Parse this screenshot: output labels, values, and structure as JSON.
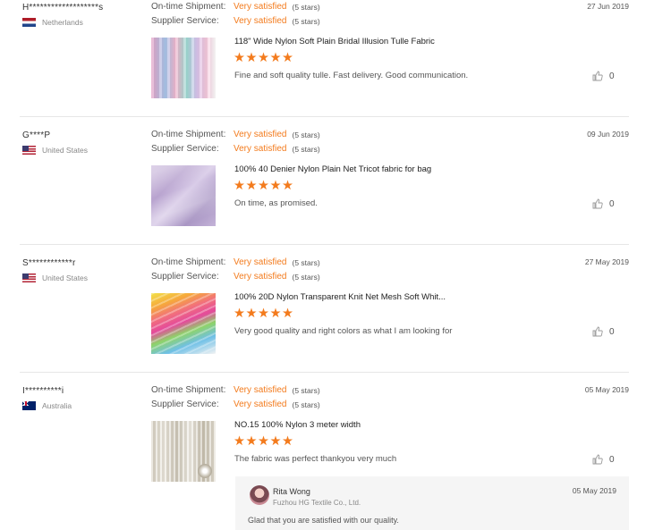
{
  "labels": {
    "on_time": "On-time Shipment:",
    "supplier": "Supplier Service:"
  },
  "colors": {
    "accent": "#f37b1d",
    "separator": "#e6e6e6",
    "reply_bg": "#f5f5f5"
  },
  "reviews": [
    {
      "buyer": "H*******************s",
      "country": "Netherlands",
      "flag": "flag-nl",
      "date": "27 Jun 2019",
      "on_time_value": "Very satisfied",
      "on_time_stars": "(5 stars)",
      "supplier_value": "Very satisfied",
      "supplier_stars": "(5 stars)",
      "product": "118\" Wide Nylon Soft Plain Bridal Illusion Tulle Fabric",
      "stars": "★★★★★",
      "rating": 5,
      "comment": "Fine and soft quality tulle. Fast delivery. Good communication.",
      "likes": "0"
    },
    {
      "buyer": "G****P",
      "country": "United States",
      "flag": "flag-us",
      "date": "09 Jun 2019",
      "on_time_value": "Very satisfied",
      "on_time_stars": "(5 stars)",
      "supplier_value": "Very satisfied",
      "supplier_stars": "(5 stars)",
      "product": "100% 40 Denier Nylon Plain Net Tricot fabric for bag",
      "stars": "★★★★★",
      "rating": 5,
      "comment": "On time, as promised.",
      "likes": "0"
    },
    {
      "buyer": "S************r",
      "country": "United States",
      "flag": "flag-us",
      "date": "27 May 2019",
      "on_time_value": "Very satisfied",
      "on_time_stars": "(5 stars)",
      "supplier_value": "Very satisfied",
      "supplier_stars": "(5 stars)",
      "product": "100% 20D Nylon Transparent Knit Net Mesh Soft Whit...",
      "stars": "★★★★★",
      "rating": 5,
      "comment": "Very good quality and right colors as what I am looking for",
      "likes": "0"
    },
    {
      "buyer": "I**********i",
      "country": "Australia",
      "flag": "flag-au",
      "date": "05 May 2019",
      "on_time_value": "Very satisfied",
      "on_time_stars": "(5 stars)",
      "supplier_value": "Very satisfied",
      "supplier_stars": "(5 stars)",
      "product": "NO.15 100% Nylon 3 meter width",
      "stars": "★★★★★",
      "rating": 5,
      "comment": "The fabric was perfect thankyou very much",
      "likes": "0"
    }
  ],
  "reply": {
    "name": "Rita Wong",
    "company": "Fuzhou HG Textile Co., Ltd.",
    "date": "05 May 2019",
    "text": "Glad that you are satisfied with our quality."
  }
}
